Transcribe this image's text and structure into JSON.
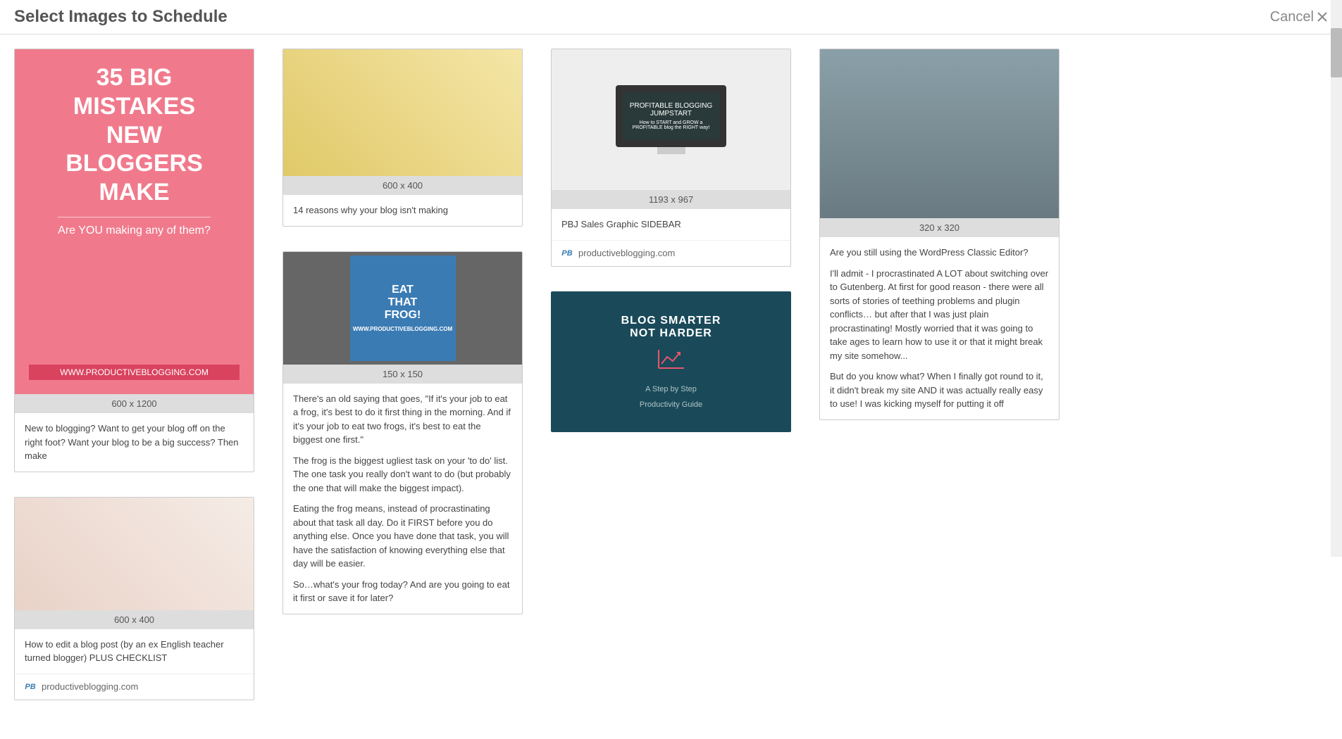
{
  "header": {
    "title": "Select Images to Schedule",
    "cancel": "Cancel"
  },
  "cards": [
    {
      "dims": "600 x 1200",
      "thumb_lines": [
        "35 BIG",
        "MISTAKES",
        "NEW",
        "BLOGGERS",
        "MAKE",
        "Are YOU making any of them?",
        "WWW.PRODUCTIVEBLOGGING.COM"
      ],
      "desc": "New to blogging? Want to get your blog off on the right foot? Want your blog to be a big success? Then make"
    },
    {
      "dims": "600 x 400",
      "desc": "How to edit a blog post (by an ex English teacher turned blogger) PLUS CHECKLIST",
      "source": "productiveblogging.com"
    },
    {
      "dims": "600 x 400",
      "desc": "14 reasons why your blog isn't making"
    },
    {
      "dims": "150 x 150",
      "thumb_lines": [
        "EAT",
        "THAT",
        "FROG!",
        "WWW.PRODUCTIVEBLOGGING.COM"
      ],
      "desc_multi": [
        "There's an old saying that goes, \"If it's your job to eat a frog, it's best to do it first thing in the morning. And if it's your job to eat two frogs, it's best to eat the biggest one first.\"",
        "The frog is the biggest ugliest task on your 'to do' list. The one task you really don't want to do (but probably the one that will make the biggest impact).",
        "Eating the frog means, instead of procrastinating about that task all day. Do it FIRST before you do anything else. Once you have done that task, you will have the satisfaction of knowing everything else that day will be easier.",
        "So…what's your frog today? And are you going to eat it first or save it for later?"
      ]
    },
    {
      "dims": "1193 x 967",
      "thumb_lines": [
        "PROFITABLE BLOGGING",
        "JUMPSTART",
        "How to START and GROW a",
        "PROFITABLE blog the RIGHT way!"
      ],
      "desc": "PBJ Sales Graphic SIDEBAR",
      "source": "productiveblogging.com"
    },
    {
      "thumb_lines": [
        "BLOG SMARTER",
        "NOT HARDER",
        "A Step by Step",
        "Productivity Guide"
      ]
    },
    {
      "dims": "320 x 320",
      "desc_multi": [
        "Are you still using the WordPress Classic Editor?",
        "I'll admit - I procrastinated A LOT about switching over to Gutenberg. At first for good reason - there were all sorts of stories of teething problems and plugin conflicts… but after that I was just plain procrastinating! Mostly worried that it was going to take ages to learn how to use it or that it might break my site somehow...",
        "But do you know what? When I finally got round to it, it didn't break my site AND it was actually really easy to use! I was kicking myself for putting it off"
      ]
    }
  ]
}
